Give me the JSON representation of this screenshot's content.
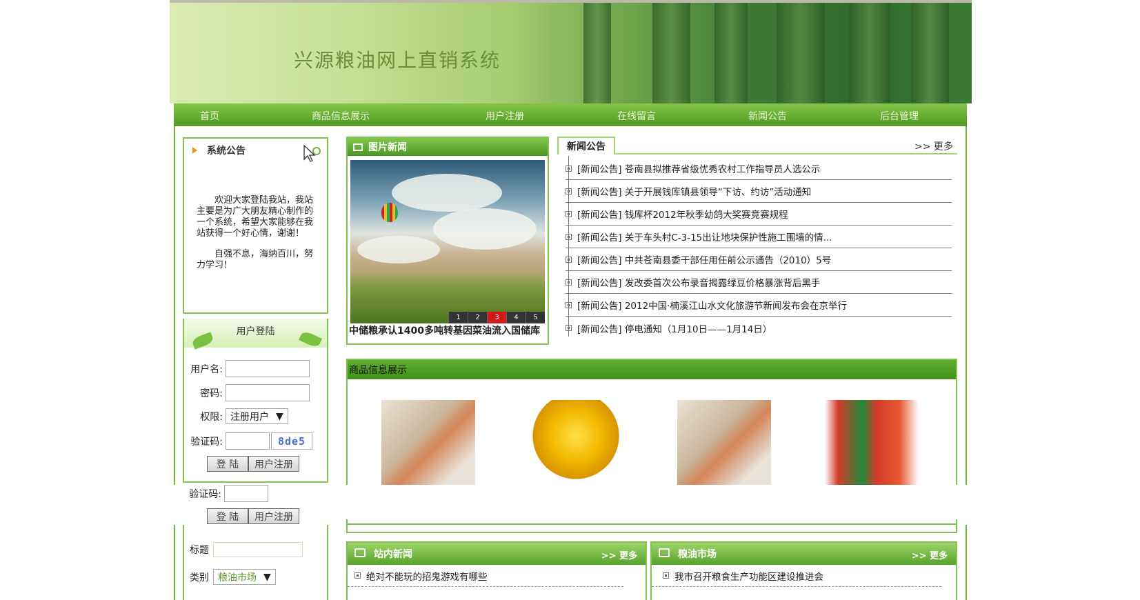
{
  "site": {
    "title": "兴源粮油网上直销系统"
  },
  "nav": [
    {
      "label": "首页"
    },
    {
      "label": "商品信息展示"
    },
    {
      "label": "用户注册"
    },
    {
      "label": "在线留言"
    },
    {
      "label": "新闻公告"
    },
    {
      "label": "后台管理"
    }
  ],
  "system_notice": {
    "title": "系统公告",
    "paragraphs": [
      "欢迎大家登陆我站，我站主要是为广大朋友精心制作的一个系统，希望大家能够在我站获得一个好心情，谢谢！",
      "自强不息，海纳百川，努力学习！"
    ]
  },
  "login": {
    "title": "用户登陆",
    "username_label": "用户名:",
    "password_label": "密码:",
    "role_label": "权限:",
    "role_value": "注册用户",
    "captcha_label": "验证码:",
    "captcha_value": "8de5",
    "login_button": "登 陆",
    "register_button": "用户注册"
  },
  "ghost_login": {
    "captcha_label": "验证码:",
    "login_button": "登 陆",
    "register_button": "用户注册"
  },
  "message_form": {
    "title_label": "标题",
    "category_label": "类别",
    "category_value": "粮油市场"
  },
  "picture_news": {
    "title": "图片新闻",
    "caption": "中储粮承认1400多吨转基因菜油流入国储库",
    "pages": [
      "1",
      "2",
      "3",
      "4",
      "5"
    ],
    "active_page": "3"
  },
  "news": {
    "tab": "新闻公告",
    "more": "更多",
    "items": [
      "[新闻公告] 苍南县拟推荐省级优秀农村工作指导员人选公示",
      "[新闻公告] 关于开展钱库镇县领导“下访、约访”活动通知",
      "[新闻公告] 钱库杯2012年秋季幼鸽大奖赛竞赛规程",
      "[新闻公告] 关于车头村C-3-15出让地块保护性施工围墙的情...",
      "[新闻公告] 中共苍南县委干部任用任前公示通告（2010）5号",
      "[新闻公告] 发改委首次公布录音揭露绿豆价格暴涨背后黑手",
      "[新闻公告] 2012中国·楠溪江山水文化旅游节新闻发布会在京举行",
      "[新闻公告] 停电通知（1月10日——1月14日）"
    ]
  },
  "products": {
    "title": "商品信息展示"
  },
  "site_news": {
    "title": "站内新闻",
    "more": "更多",
    "items": [
      "绝对不能玩的招鬼游戏有哪些"
    ]
  },
  "grain_market": {
    "title": "粮油市场",
    "more": "更多",
    "items": [
      "我市召开粮食生产功能区建设推进会"
    ]
  },
  "colors": {
    "nav_green": "#4f9a22",
    "border_green": "#83c252",
    "captcha_blue": "#4a6fd0",
    "pager_active": "#d21a1a"
  }
}
